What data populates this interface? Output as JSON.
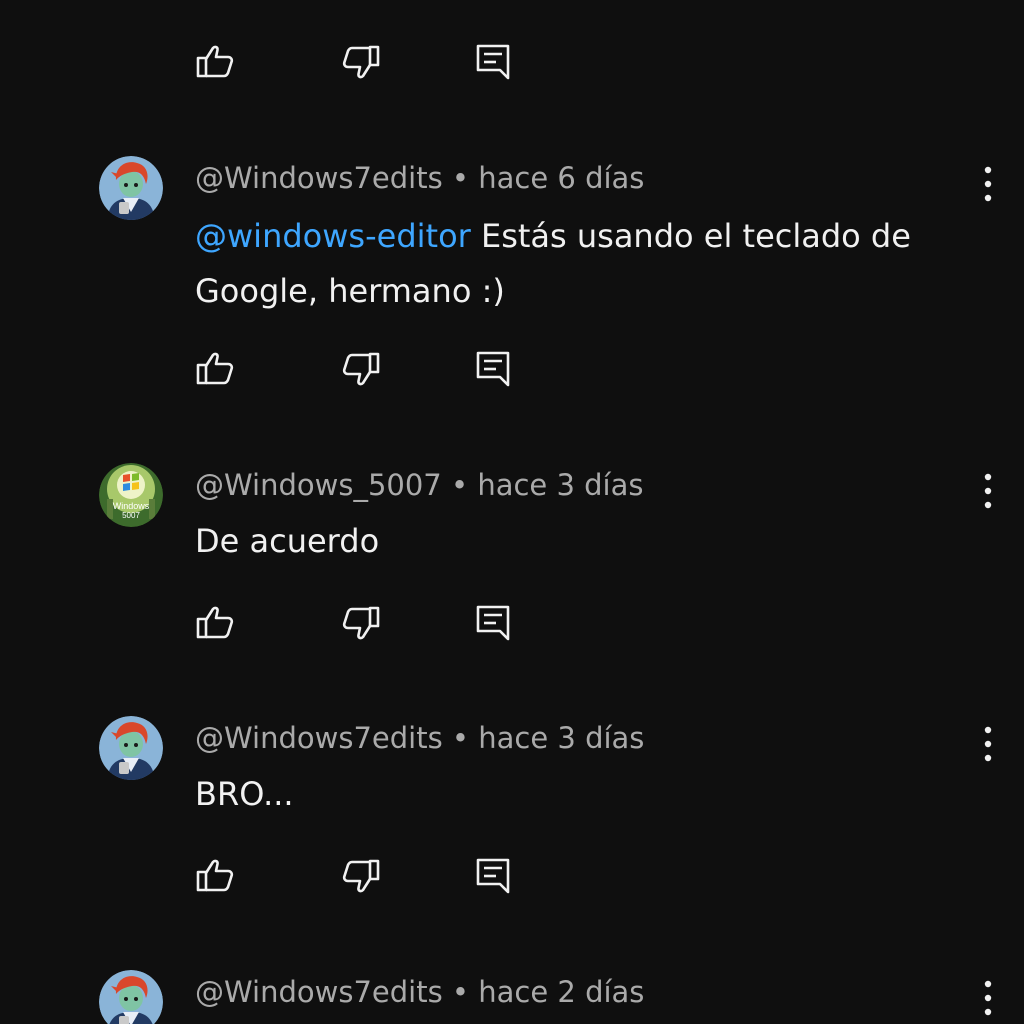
{
  "top_actions": {
    "like_icon": "thumb-up-icon",
    "dislike_icon": "thumb-down-icon",
    "reply_icon": "reply-icon"
  },
  "comments": [
    {
      "handle": "@Windows7edits",
      "separator": "•",
      "time": "hace 6 días",
      "mention": "@windows-editor",
      "text": "Estás usando el teclado de Google, hermano :)",
      "avatar_icon": "anime-character-avatar"
    },
    {
      "handle": "@Windows_5007",
      "separator": "•",
      "time": "hace 3 días",
      "mention": "",
      "text": "De acuerdo",
      "avatar_icon": "windows-logo-avatar",
      "avatar_text_line1": "Windows",
      "avatar_text_line2": "5007"
    },
    {
      "handle": "@Windows7edits",
      "separator": "•",
      "time": "hace 3 días",
      "mention": "",
      "text": "BRO...",
      "avatar_icon": "anime-character-avatar"
    },
    {
      "handle": "@Windows7edits",
      "separator": "•",
      "time": "hace 2 días",
      "mention": "",
      "text": "",
      "avatar_icon": "anime-character-avatar"
    }
  ],
  "colors": {
    "background": "#0f0f0f",
    "meta_text": "#aaaaaa",
    "body_text": "#f1f1f1",
    "mention": "#3ea6ff"
  }
}
